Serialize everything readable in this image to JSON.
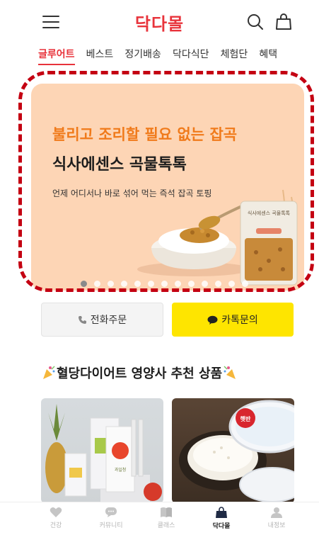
{
  "header": {
    "logo": "닥다몰"
  },
  "tabs": [
    {
      "label": "글루어트",
      "active": true
    },
    {
      "label": "베스트"
    },
    {
      "label": "정기배송"
    },
    {
      "label": "닥다식단"
    },
    {
      "label": "체험단"
    },
    {
      "label": "혜택"
    }
  ],
  "banner": {
    "kicker": "불리고 조리할 필요 없는 잡곡",
    "title": "식사에센스 곡물톡톡",
    "description": "언제 어디서나 바로 섞어 먹는 즉석 잡곡 토핑",
    "product_pack_text": "식사에센스 곡물톡톡",
    "dot_count": 13,
    "active_dot": 0
  },
  "actions": {
    "call_label": "전화주문",
    "kakao_label": "카톡문의"
  },
  "section": {
    "title": "혈당다이어트 영양사 추천 상품"
  },
  "products": [
    {
      "pack_label": "과일청"
    },
    {
      "pack_label": "햇반"
    }
  ],
  "bottom_nav": [
    {
      "label": "건강",
      "icon": "heart-icon"
    },
    {
      "label": "커뮤니티",
      "icon": "chat-icon"
    },
    {
      "label": "클래스",
      "icon": "book-icon"
    },
    {
      "label": "닥다몰",
      "icon": "shopping-bag-icon",
      "active": true
    },
    {
      "label": "내정보",
      "icon": "person-icon"
    }
  ],
  "colors": {
    "brand": "#e8333b",
    "banner_bg": "#fdd5b5",
    "kicker": "#f07a1a",
    "kakao": "#fee500",
    "highlight_outline": "#c40012"
  }
}
